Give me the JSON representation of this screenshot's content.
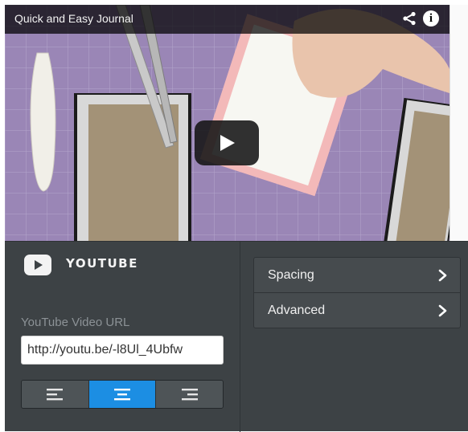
{
  "video": {
    "title": "Quick and Easy Journal",
    "icons": [
      "share-icon",
      "info-icon",
      "play-icon"
    ]
  },
  "module": {
    "title": "YOUTUBE",
    "icon": "youtube-icon"
  },
  "url_field": {
    "label": "YouTube Video URL",
    "value": "http://youtu.be/-l8Ul_4Ubfw"
  },
  "alignment": {
    "options": [
      "align-left",
      "align-center",
      "align-right"
    ],
    "selected": "align-center"
  },
  "settings": {
    "items": [
      {
        "label": "Spacing",
        "icon": "chevron-right-icon"
      },
      {
        "label": "Advanced",
        "icon": "chevron-right-icon"
      }
    ]
  },
  "colors": {
    "panel_bg": "#3d4245",
    "accent": "#1c8ee3",
    "video_overlay": "#000000"
  }
}
